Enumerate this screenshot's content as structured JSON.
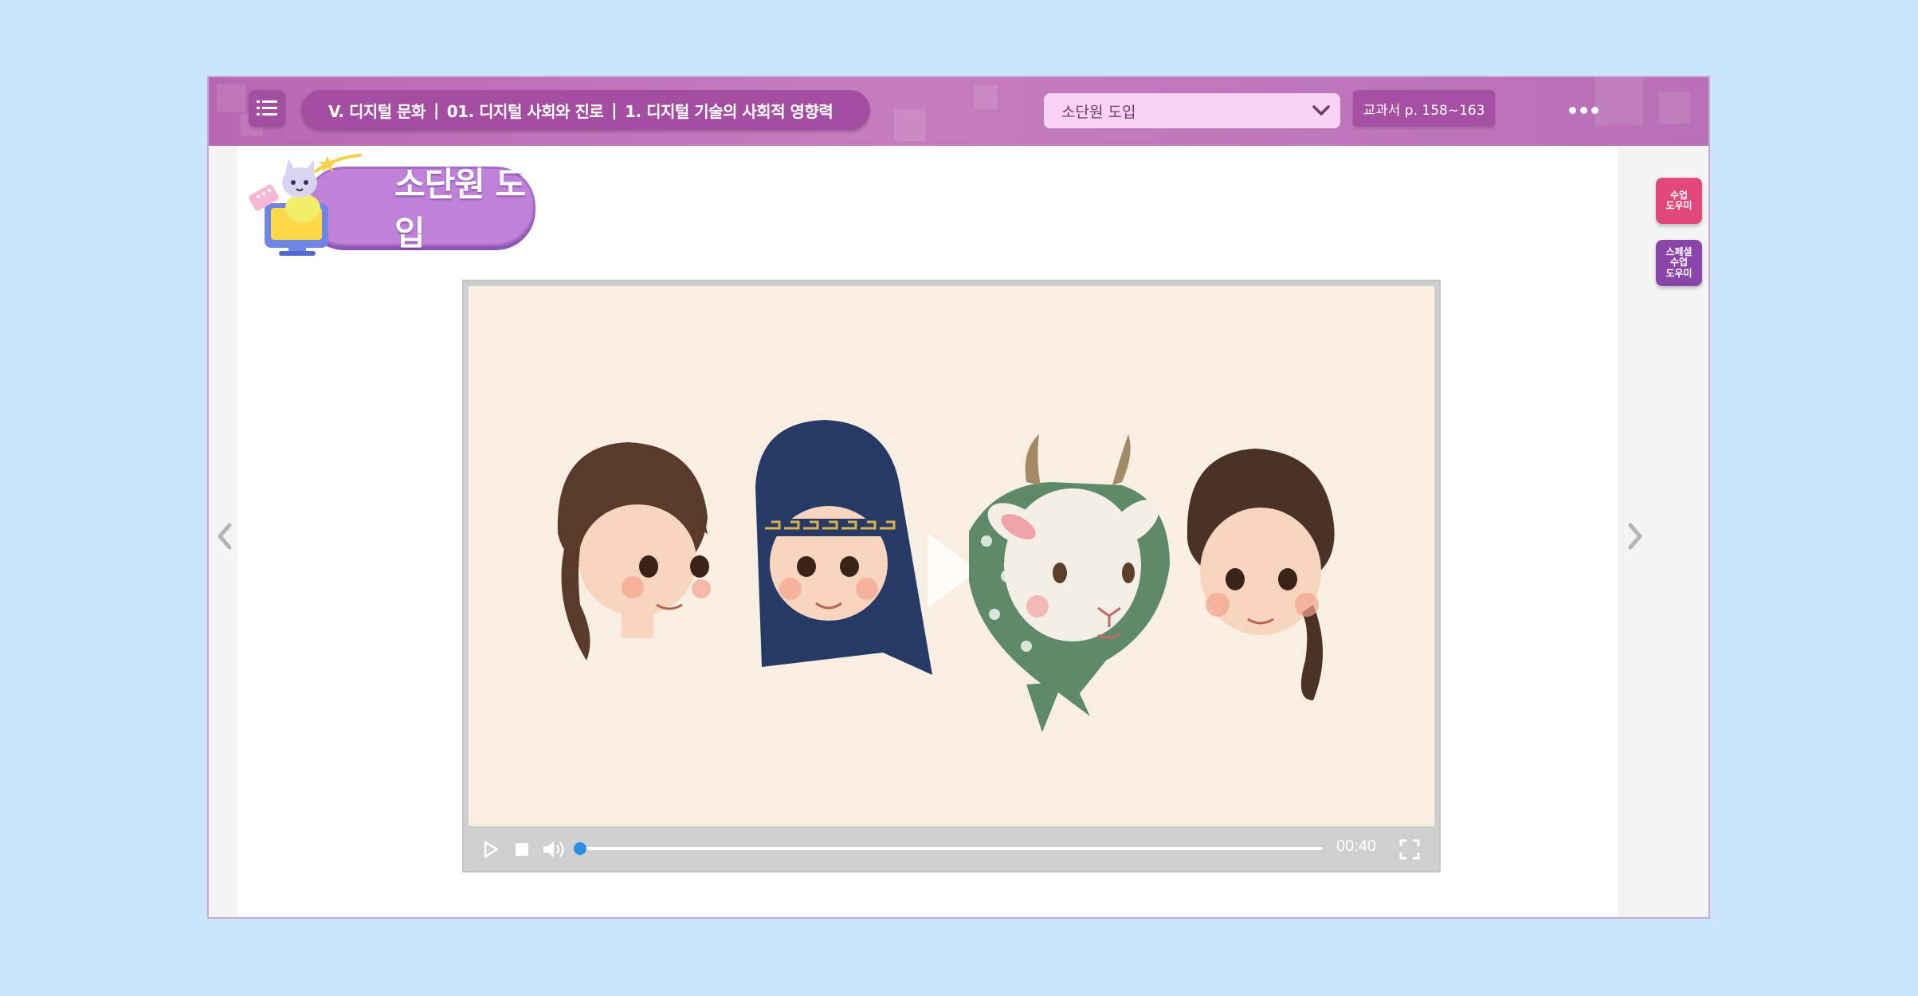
{
  "header": {
    "breadcrumb": {
      "unit": "V. 디지털 문화",
      "chapter": "01. 디지털 사회와 진로",
      "lesson": "1. 디지털 기술의 사회적 영향력"
    },
    "section_select": {
      "selected": "소단원 도입"
    },
    "textbook_pages": "교과서 p. 158~163"
  },
  "section_banner": {
    "title": "소단원 도입"
  },
  "side_buttons": [
    {
      "label": "수업\n도우미",
      "color": "#e0487c"
    },
    {
      "label": "스페셜\n수업\n도우미",
      "color": "#8a45a8"
    }
  ],
  "video": {
    "time": "00:40",
    "progress": 0.0,
    "icons": [
      "play-icon",
      "stop-icon",
      "volume-icon",
      "fullscreen-icon"
    ]
  },
  "colors": {
    "background": "#cde5fb",
    "header": "#c07bbd",
    "header_dark": "#a34ea0",
    "dropdown": "#f9d2f6",
    "banner": "#c082d8",
    "progress_thumb": "#2a8ee3"
  }
}
